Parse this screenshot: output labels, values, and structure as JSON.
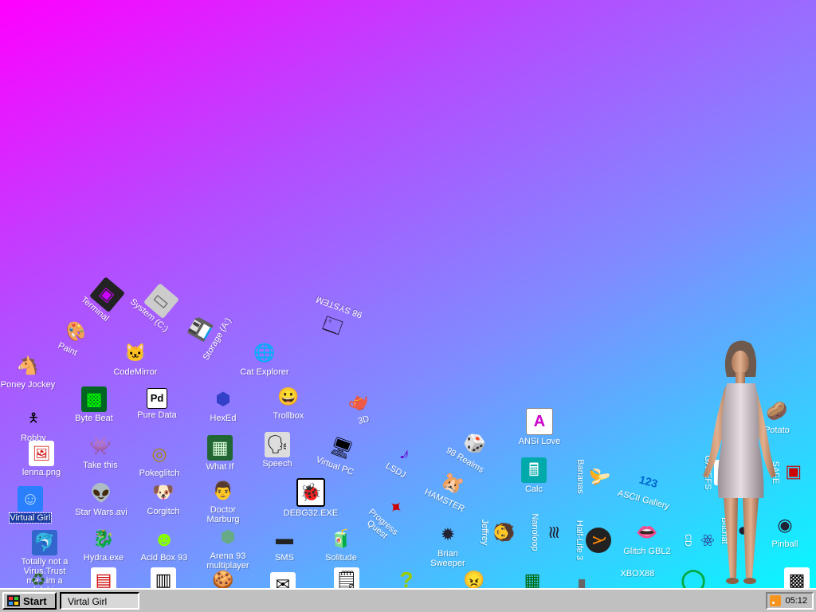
{
  "desktop": {
    "icons": [
      {
        "label": "Terminal",
        "icon": "terminal-icon",
        "glyph": "▣"
      },
      {
        "label": "System (C:)",
        "icon": "hard-drive-icon",
        "glyph": "▭"
      },
      {
        "label": "Paint",
        "icon": "paint-palette-icon",
        "glyph": "🎨"
      },
      {
        "label": "Storage (A:)",
        "icon": "floppy-drive-icon",
        "glyph": "💾"
      },
      {
        "label": "98 SYSTEM",
        "icon": "system-window-icon",
        "glyph": "🗔"
      },
      {
        "label": "CodeMirror",
        "icon": "codemirror-icon",
        "glyph": "🐱"
      },
      {
        "label": "Cat Explorer",
        "icon": "cat-explorer-icon",
        "glyph": "🌐"
      },
      {
        "label": "Poney Jockey",
        "icon": "pony-icon",
        "glyph": "🐴"
      },
      {
        "label": "Robby",
        "icon": "stick-figure-icon",
        "glyph": "🯅"
      },
      {
        "label": "Byte Beat",
        "icon": "byte-beat-icon",
        "glyph": "▩"
      },
      {
        "label": "Pure Data",
        "icon": "pure-data-icon",
        "glyph": "Pd"
      },
      {
        "label": "HexEd",
        "icon": "hex-editor-icon",
        "glyph": "⬢"
      },
      {
        "label": "Trollbox",
        "icon": "chat-smiley-icon",
        "glyph": "😀"
      },
      {
        "label": "3D",
        "icon": "teapot-icon",
        "glyph": "🫖"
      },
      {
        "label": "lenna.png",
        "icon": "image-file-icon",
        "glyph": "🖼"
      },
      {
        "label": "Take this",
        "icon": "pixel-character-icon",
        "glyph": "👾"
      },
      {
        "label": "Pokeglitch",
        "icon": "pokeglitch-icon",
        "glyph": "◎"
      },
      {
        "label": "What If",
        "icon": "what-if-icon",
        "glyph": "▦"
      },
      {
        "label": "Speech",
        "icon": "speech-face-icon",
        "glyph": "🗣"
      },
      {
        "label": "Virtual PC",
        "icon": "virtual-pc-icon",
        "glyph": "🖥"
      },
      {
        "label": "LSDJ",
        "icon": "lsdj-icon",
        "glyph": "♪"
      },
      {
        "label": "98 Realms",
        "icon": "realms-icon",
        "glyph": "🎲"
      },
      {
        "label": "ANSI Love",
        "icon": "ansi-letter-icon",
        "glyph": "A"
      },
      {
        "label": "Virtual Girl",
        "icon": "virtual-girl-icon",
        "glyph": "☺"
      },
      {
        "label": "Star Wars.avi",
        "icon": "yoda-icon",
        "glyph": "👽"
      },
      {
        "label": "Corgitch",
        "icon": "corgi-icon",
        "glyph": "🐶"
      },
      {
        "label": "Doctor Marburg",
        "icon": "doctor-icon",
        "glyph": "👨"
      },
      {
        "label": "DEBG32.EXE",
        "icon": "debugger-icon",
        "glyph": "🐞"
      },
      {
        "label": "HAMSTER",
        "icon": "hamster-icon",
        "glyph": "🐹"
      },
      {
        "label": "Calc",
        "icon": "calculator-icon",
        "glyph": "🖩"
      },
      {
        "label": "Bananas",
        "icon": "banana-icon",
        "glyph": "🍌"
      },
      {
        "label": "ASCII Gallery",
        "icon": "ascii-gallery-icon",
        "glyph": "123"
      },
      {
        "label": "Totally not a Virus.Trust me...im a dolphin",
        "icon": "dolphin-icon",
        "glyph": "🐬"
      },
      {
        "label": "Hydra.exe",
        "icon": "hydra-icon",
        "glyph": "🐉"
      },
      {
        "label": "Acid Box 93",
        "icon": "acid-smiley-icon",
        "glyph": "☻"
      },
      {
        "label": "Arena 93 multiplayer",
        "icon": "arena-cube-icon",
        "glyph": "⬢"
      },
      {
        "label": "SMS",
        "icon": "sms-icon",
        "glyph": "▬"
      },
      {
        "label": "Solitude",
        "icon": "solitude-icon",
        "glyph": "🧃"
      },
      {
        "label": "Progress Quest",
        "icon": "progress-quest-icon",
        "glyph": "✦"
      },
      {
        "label": "Brian Sweeper",
        "icon": "mine-sweeper-icon",
        "glyph": "✹"
      },
      {
        "label": "Jeffrey",
        "icon": "jeffrey-icon",
        "glyph": "🧑"
      },
      {
        "label": "Nanoloop",
        "icon": "nanoloop-icon",
        "glyph": "≋"
      },
      {
        "label": "Half-Life 3",
        "icon": "half-life-icon",
        "glyph": "λ"
      },
      {
        "label": "Glitch GBL2",
        "icon": "lips-icon",
        "glyph": "👄"
      },
      {
        "label": "CD",
        "icon": "atom-icon",
        "glyph": "⚛"
      },
      {
        "label": "Bitchat",
        "icon": "bitchat-icon",
        "glyph": "●"
      },
      {
        "label": "Pinball",
        "icon": "pinball-icon",
        "glyph": "◉"
      },
      {
        "label": "Potato",
        "icon": "potato-icon",
        "glyph": "🥔"
      },
      {
        "label": "GATEFS",
        "icon": "gate-icon",
        "glyph": "▯"
      },
      {
        "label": "SAFE",
        "icon": "safe-icon",
        "glyph": "▣"
      },
      {
        "label": "Recycle",
        "icon": "recycle-bin-icon",
        "glyph": "♻"
      },
      {
        "label": "Defrag",
        "icon": "defrag-icon",
        "glyph": "▤"
      },
      {
        "label": "XBOX88",
        "icon": "xbox-icon",
        "glyph": "▭"
      },
      {
        "label": "Donut",
        "icon": "donut-icon",
        "glyph": "◯"
      },
      {
        "label": "Cookie",
        "icon": "cookie-icon",
        "glyph": "🍪"
      },
      {
        "label": "Question",
        "icon": "question-mark-icon",
        "glyph": "?"
      },
      {
        "label": "Duke",
        "icon": "duke-face-icon",
        "glyph": "😠"
      },
      {
        "label": "Notepad",
        "icon": "notepad-icon",
        "glyph": "🗒"
      },
      {
        "label": "Fontbook",
        "icon": "fontbook-icon",
        "glyph": "▥"
      },
      {
        "label": "Mail",
        "icon": "mail-icon",
        "glyph": "✉"
      },
      {
        "label": "Pocket",
        "icon": "pocket-icon",
        "glyph": "▮"
      },
      {
        "label": "Calendar",
        "icon": "calendar-icon",
        "glyph": "▦"
      },
      {
        "label": "Board",
        "icon": "board-icon",
        "glyph": "▩"
      }
    ]
  },
  "taskbar": {
    "start_label": "Start",
    "task_label": "Virtal Girl",
    "clock": "05:12"
  }
}
